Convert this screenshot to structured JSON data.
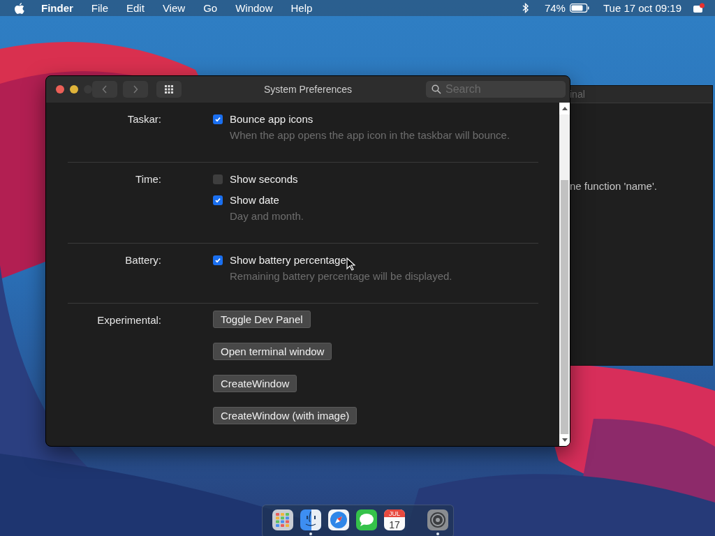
{
  "menu_bar": {
    "app_name": "Finder",
    "items": [
      "File",
      "Edit",
      "View",
      "Go",
      "Window",
      "Help"
    ],
    "battery": "74%",
    "clock": "Tue 17 oct 09:19"
  },
  "background_window": {
    "title": "inal",
    "text": "ne function 'name'."
  },
  "window": {
    "title": "System Preferences",
    "search": {
      "placeholder": "Search"
    },
    "sections": [
      {
        "label": "Taskar:",
        "kind": "options",
        "options": [
          {
            "label": "Bounce app icons",
            "checked": true,
            "description": "When the app opens the app icon in the taskbar will bounce."
          }
        ]
      },
      {
        "label": "Time:",
        "kind": "options",
        "options": [
          {
            "label": "Show seconds",
            "checked": false
          },
          {
            "label": "Show date",
            "checked": true,
            "description": "Day and month."
          }
        ]
      },
      {
        "label": "Battery:",
        "kind": "options",
        "options": [
          {
            "label": "Show battery percentage",
            "checked": true,
            "description": "Remaining battery percentage will be displayed."
          }
        ]
      },
      {
        "label": "Experimental:",
        "kind": "buttons",
        "buttons": [
          "Toggle Dev Panel",
          "Open terminal window",
          "CreateWindow",
          "CreateWindow (with image)"
        ]
      }
    ]
  },
  "dock": [
    {
      "kind": "launchpad",
      "running": false
    },
    {
      "kind": "finder",
      "running": true
    },
    {
      "kind": "safari",
      "running": false
    },
    {
      "kind": "messages",
      "running": false
    },
    {
      "kind": "calendar",
      "running": false,
      "month": "JUL",
      "day": "17"
    },
    {
      "kind": "divider"
    },
    {
      "kind": "settings",
      "running": true
    }
  ]
}
